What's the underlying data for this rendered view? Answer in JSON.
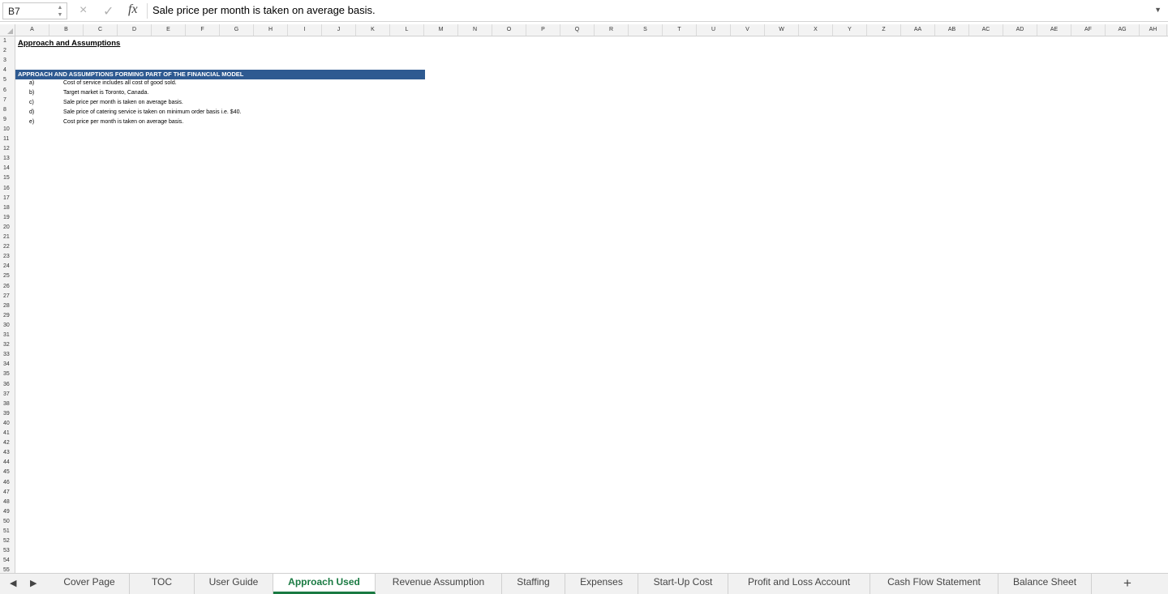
{
  "formula_bar": {
    "cell_ref": "B7",
    "cancel_icon": "×",
    "enter_icon": "✓",
    "fx_label": "fx",
    "content": "Sale price per month is taken on average basis."
  },
  "columns": [
    "A",
    "B",
    "C",
    "D",
    "E",
    "F",
    "G",
    "H",
    "I",
    "J",
    "K",
    "L",
    "M",
    "N",
    "O",
    "P",
    "Q",
    "R",
    "S",
    "T",
    "U",
    "V",
    "W",
    "X",
    "Y",
    "Z",
    "AA",
    "AB",
    "AC",
    "AD",
    "AE",
    "AF",
    "AG",
    "AH"
  ],
  "rows": [
    "1",
    "2",
    "3",
    "4",
    "5",
    "6",
    "7",
    "8",
    "9",
    "10",
    "11",
    "12",
    "13",
    "14",
    "15",
    "16",
    "17",
    "18",
    "19",
    "20",
    "21",
    "22",
    "23",
    "24",
    "25",
    "26",
    "27",
    "28",
    "29",
    "30",
    "31",
    "32",
    "33",
    "34",
    "35",
    "36",
    "37",
    "38",
    "39",
    "40",
    "41",
    "42",
    "43",
    "44",
    "45",
    "46",
    "47",
    "48",
    "49",
    "50",
    "51",
    "52",
    "53",
    "54",
    "55"
  ],
  "sheet": {
    "title": "Approach and Assumptions",
    "banner": "APPROACH AND ASSUMPTIONS FORMING PART OF THE FINANCIAL MODEL",
    "assumptions": [
      {
        "label": "a)",
        "text": "Cost of service includes all cost of good sold."
      },
      {
        "label": "b)",
        "text": "Target market is Toronto, Canada."
      },
      {
        "label": "c)",
        "text": "Sale price per month is taken on average basis."
      },
      {
        "label": "d)",
        "text": "Sale price of catering service is taken on minimum order basis i.e. $40."
      },
      {
        "label": "e)",
        "text": "Cost price per month is taken on average basis."
      }
    ],
    "banner_color": "#2e5a91"
  },
  "tabs": [
    {
      "label": "Cover Page"
    },
    {
      "label": "TOC"
    },
    {
      "label": "User Guide"
    },
    {
      "label": "Approach Used",
      "active": true
    },
    {
      "label": "Revenue Assumption"
    },
    {
      "label": "Staffing"
    },
    {
      "label": "Expenses"
    },
    {
      "label": "Start-Up Cost"
    },
    {
      "label": "Profit and Loss Account"
    },
    {
      "label": "Cash Flow Statement"
    },
    {
      "label": "Balance Sheet"
    }
  ],
  "tab_nav": {
    "prev_icon": "◀",
    "next_icon": "▶",
    "add_icon": "+"
  },
  "active_tab_color": "#1a7a42"
}
